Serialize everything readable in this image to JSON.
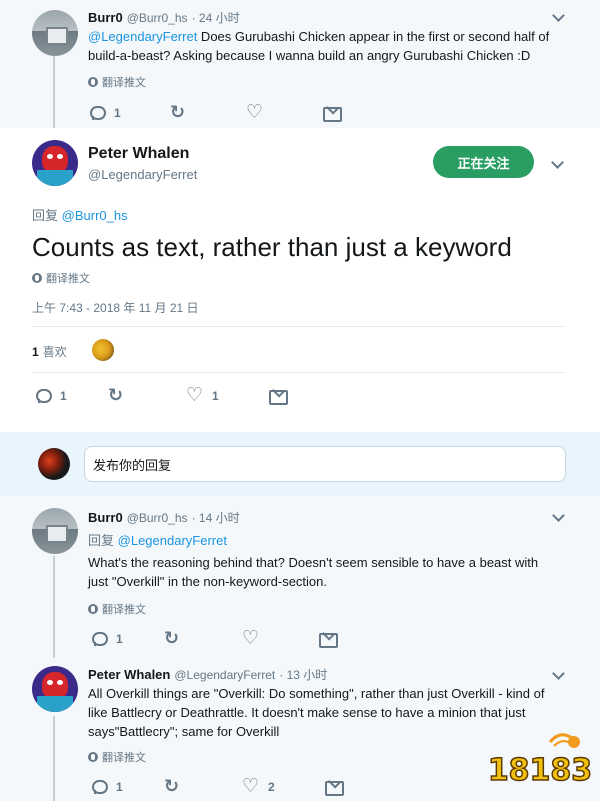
{
  "tweet1": {
    "name": "Burr0",
    "handle": "@Burr0_hs",
    "time": "· 24 小时",
    "mention": "@LegendaryFerret",
    "text_line1": " Does Gurubashi Chicken appear in the first or second half of",
    "text_line2": "build-a-beast? Asking because I wanna build an angry Gurubashi Chicken :D",
    "translate": "翻译推文",
    "reply_count": "1",
    "retweet_count": "",
    "like_count": ""
  },
  "main_tweet": {
    "name": "Peter Whalen",
    "handle": "@LegendaryFerret",
    "follow_label": "正在关注",
    "reply_prefix": "回复",
    "reply_to": "@Burr0_hs",
    "text": "Counts as text, rather than just a keyword",
    "translate": "翻译推文",
    "timestamp": "上午 7:43 - 2018 年 11 月 21 日",
    "likes_count": "1",
    "likes_label": "喜欢",
    "reply_count": "1",
    "like_count": "1"
  },
  "compose": {
    "placeholder": "发布你的回复"
  },
  "tweet2": {
    "name": "Burr0",
    "handle": "@Burr0_hs",
    "time": "· 14 小时",
    "reply_prefix": "回复",
    "reply_to": "@LegendaryFerret",
    "text_line1": "What's the reasoning behind that? Doesn't seem sensible to have a beast with",
    "text_line2": "just \"Overkill\" in the non-keyword-section.",
    "translate": "翻译推文",
    "reply_count": "1"
  },
  "tweet3": {
    "name": "Peter Whalen",
    "handle": "@LegendaryFerret",
    "time": "· 13 小时",
    "text_line1": "All Overkill things are \"Overkill: Do something\", rather than just Overkill - kind of",
    "text_line2": "like Battlecry or Deathrattle.  It doesn't make sense to have a minion that just",
    "text_line3": "says\"Battlecry\"; same for Overkill",
    "translate": "翻译推文",
    "reply_count": "1",
    "like_count": "2"
  },
  "watermark": {
    "text": "18183"
  },
  "colors": {
    "follow_green": "#2a9d63",
    "mention_blue": "#1b95e0",
    "thread_line": "#c4cfd6",
    "grey_text": "#657786"
  }
}
